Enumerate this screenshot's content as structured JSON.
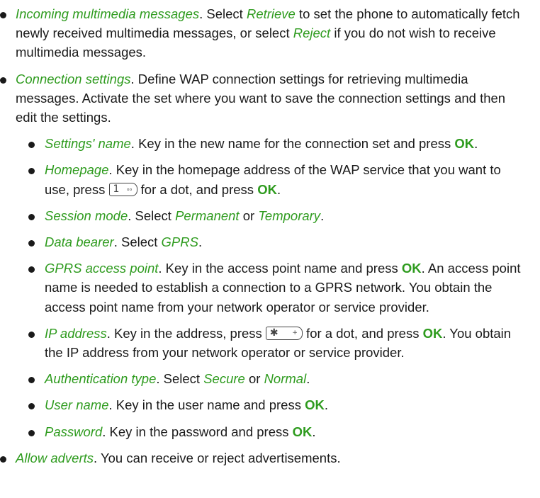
{
  "items": [
    {
      "term": "Incoming multimedia messages",
      "t1": ". Select ",
      "e1": "Retrieve",
      "t2": " to set the phone to automatically fetch newly received multimedia messages, or select ",
      "e2": "Reject",
      "t3": " if you do not wish to receive multimedia messages."
    },
    {
      "term": "Connection settings",
      "t1": ". Define WAP connection settings for retrieving multimedia messages. Activate the set where you want to save the connection settings and then edit the settings."
    }
  ],
  "sub": [
    {
      "term": "Settings' name",
      "t1": ". Key in the new name for the connection set and press ",
      "k1": "OK",
      "t2": "."
    },
    {
      "term": "Homepage",
      "t1": ". Key in the homepage address of the WAP service that you want to use, press ",
      "t2": " for a dot, and press ",
      "k1": "OK",
      "t3": "."
    },
    {
      "term": "Session mode",
      "t1": ". Select ",
      "e1": "Permanent",
      "t2": " or ",
      "e2": "Temporary",
      "t3": "."
    },
    {
      "term": "Data bearer",
      "t1": ". Select ",
      "e1": "GPRS",
      "t2": "."
    },
    {
      "term": "GPRS access point",
      "t1": ". Key in the access point name and press ",
      "k1": "OK",
      "t2": ". An access point name is needed to establish a connection to a GPRS network. You obtain the access point name from your network operator or service provider."
    },
    {
      "term": "IP address",
      "t1": ". Key in the address, press ",
      "t2": " for a dot, and press ",
      "k1": "OK",
      "t3": ". You obtain the IP address from your network operator or service provider."
    },
    {
      "term": "Authentication type",
      "t1": ". Select ",
      "e1": "Secure",
      "t2": " or ",
      "e2": "Normal",
      "t3": "."
    },
    {
      "term": "User name",
      "t1": ". Key in the user name and press ",
      "k1": "OK",
      "t2": "."
    },
    {
      "term": "Password",
      "t1": ". Key in the password and press ",
      "k1": "OK",
      "t2": "."
    }
  ],
  "last": {
    "term": "Allow adverts",
    "t1": ". You can receive or reject advertisements."
  },
  "keys": {
    "one": {
      "main": "1",
      "small": "ₒₒ"
    },
    "star": {
      "main": "✱",
      "small": "+"
    }
  }
}
